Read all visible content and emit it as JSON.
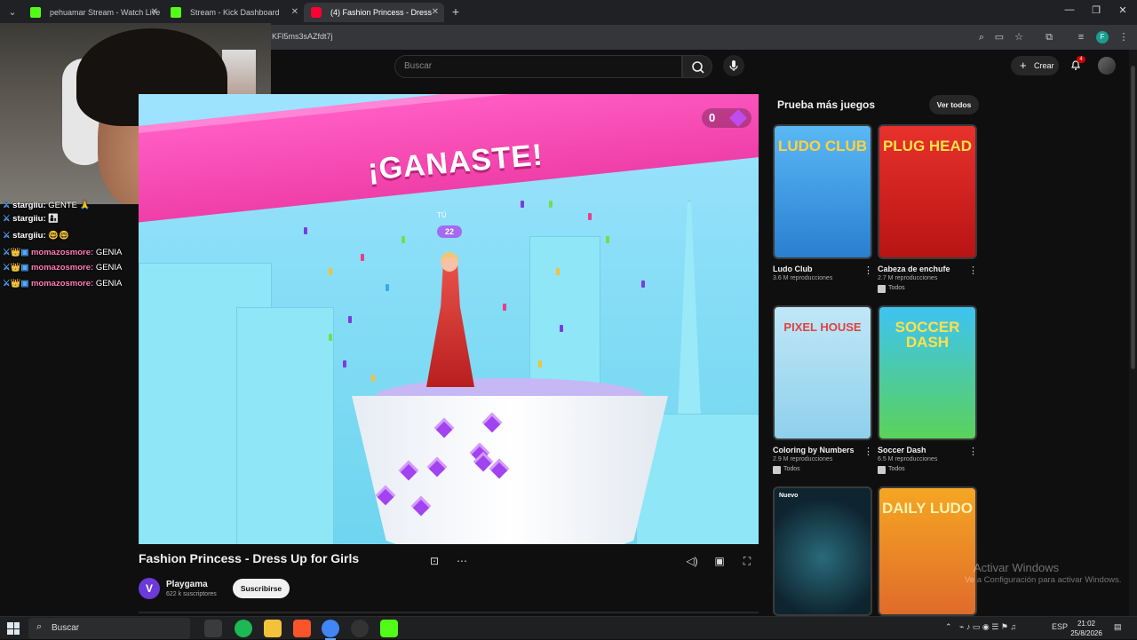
{
  "browser": {
    "tabs": [
      {
        "title": "pehuamar Stream - Watch Live",
        "favicon_color": "#53fc18",
        "active": false
      },
      {
        "title": "Stream - Kick Dashboard",
        "favicon_color": "#53fc18",
        "active": false
      },
      {
        "title": "(4) Fashion Princess - Dress",
        "favicon_color": "#ff0033",
        "active": true
      }
    ],
    "new_tab": "+",
    "url": "KFl5ms3sAZfdt7j",
    "profile_initial": "F"
  },
  "youtube": {
    "search_placeholder": "Buscar",
    "create_label": "Crear",
    "notification_count": "4"
  },
  "chat": [
    {
      "user": "stargiiu:",
      "message": "GENTE 🙏",
      "y": 0
    },
    {
      "user": "stargiiu:",
      "message": "👩‍👦",
      "y": 1
    },
    {
      "user": "stargiiu:",
      "message": "🤓🤓",
      "y": 2
    },
    {
      "user": "momazosmore:",
      "message": "GENIA",
      "y": 3
    },
    {
      "user": "momazosmore:",
      "message": "GENIA",
      "y": 4
    },
    {
      "user": "momazosmore:",
      "message": "GENIA",
      "y": 5
    }
  ],
  "game": {
    "banner_text": "¡GANASTE!",
    "gem_count": "0",
    "player_label": "TÚ",
    "player_score": "22"
  },
  "video": {
    "title": "Fashion Princess - Dress Up for Girls",
    "channel": "Playgama",
    "subscribers": "622 k suscriptores",
    "subscribe_label": "Suscribirse"
  },
  "sidebar": {
    "title": "Prueba más juegos",
    "view_all": "Ver todos",
    "cards": [
      {
        "title": "Ludo Club",
        "views": "3.6 M reproducciones",
        "tag": "",
        "thumb_text": "LUDO CLUB",
        "colors": [
          "#5ab8f5",
          "#2a7fd0"
        ],
        "label_color": "#ffd23c"
      },
      {
        "title": "Cabeza de enchufe",
        "views": "2.7 M reproducciones",
        "tag": "Todos",
        "thumb_text": "PLUG HEAD",
        "colors": [
          "#e8312c",
          "#b81414"
        ],
        "label_color": "#ffe14a"
      },
      {
        "title": "Coloring by Numbers...",
        "views": "2.9 M reproducciones",
        "tag": "Todos",
        "thumb_text": "PIXEL HOUSE",
        "colors": [
          "#bfe7f7",
          "#8fd0ec"
        ],
        "label_color": "#e0413f"
      },
      {
        "title": "Soccer Dash",
        "views": "6.5 M reproducciones",
        "tag": "Todos",
        "thumb_text": "SOCCER DASH",
        "colors": [
          "#3ec3f3",
          "#5ad25a"
        ],
        "label_color": "#ffe14a"
      },
      {
        "title": "",
        "views": "",
        "tag": "",
        "thumb_text": "",
        "badge": "Nuevo",
        "colors": [
          "#1b3c4a",
          "#0e2530"
        ],
        "label_color": "#ffffff"
      },
      {
        "title": "",
        "views": "",
        "tag": "",
        "thumb_text": "DAILY LUDO",
        "colors": [
          "#f5a623",
          "#e06b2a"
        ],
        "label_color": "#fff3b0"
      }
    ]
  },
  "windows": {
    "watermark_title": "Activar Windows",
    "watermark_sub": "Ve a Configuración para activar Windows.",
    "search": "Buscar",
    "lang": "ESP",
    "time": "21:02",
    "date": "25/8/2026"
  }
}
